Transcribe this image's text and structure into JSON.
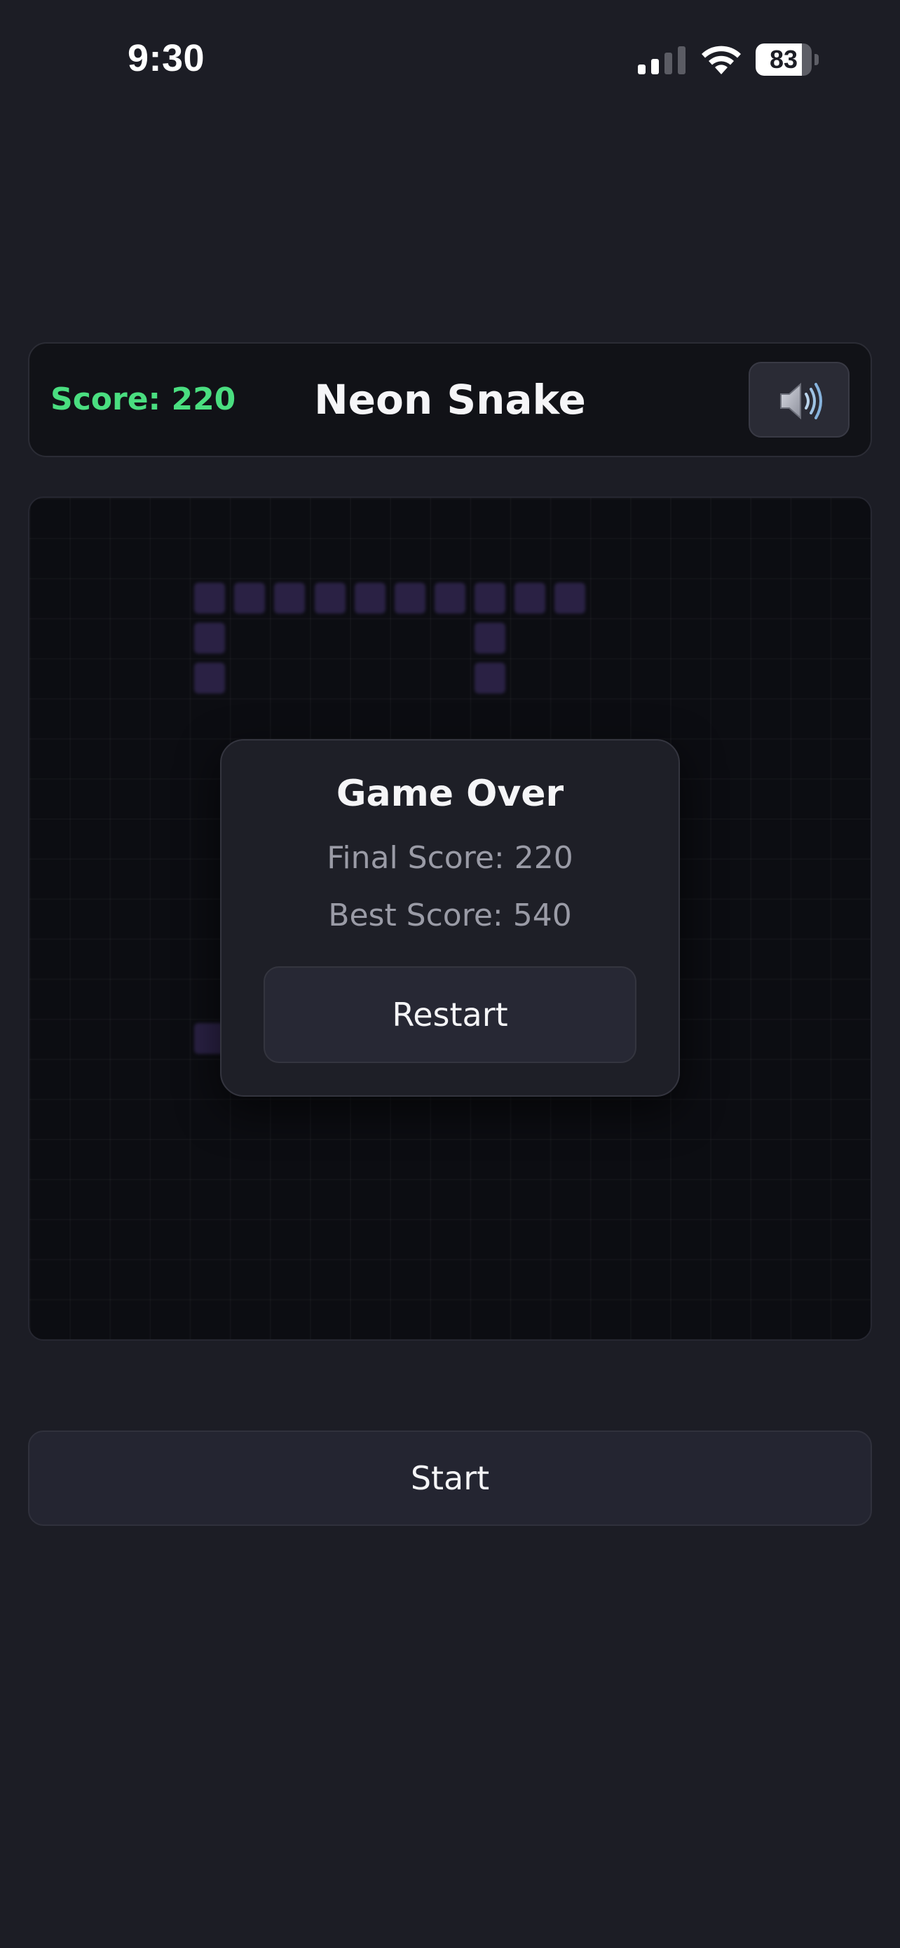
{
  "status_bar": {
    "time": "9:30",
    "signal_bars": 2,
    "signal_icon": "cellular-signal-icon",
    "wifi_icon": "wifi-icon",
    "battery_level": "83",
    "battery_fraction": 0.83
  },
  "header": {
    "score_label": "Score: 220",
    "title": "Neon Snake",
    "sound_icon": "speaker-volume-icon"
  },
  "game": {
    "grid_columns": 21,
    "grid_rows": 21,
    "snake_color": "#2c2347",
    "snake_cells": [
      [
        4,
        2
      ],
      [
        5,
        2
      ],
      [
        6,
        2
      ],
      [
        7,
        2
      ],
      [
        8,
        2
      ],
      [
        9,
        2
      ],
      [
        10,
        2
      ],
      [
        11,
        2
      ],
      [
        12,
        2
      ],
      [
        13,
        2
      ],
      [
        4,
        3
      ],
      [
        11,
        3
      ],
      [
        4,
        4
      ],
      [
        11,
        4
      ],
      [
        4,
        13
      ],
      [
        5,
        13
      ],
      [
        6,
        13
      ],
      [
        7,
        13
      ],
      [
        8,
        13
      ],
      [
        9,
        13
      ],
      [
        10,
        13
      ],
      [
        11,
        13
      ]
    ]
  },
  "dialog": {
    "title": "Game Over",
    "final_score": "Final Score: 220",
    "best_score": "Best Score: 540",
    "restart_label": "Restart"
  },
  "controls": {
    "start_label": "Start"
  },
  "colors": {
    "background": "#1c1d25",
    "score_green": "#4ade80",
    "muted_text": "#9a9ba6"
  }
}
